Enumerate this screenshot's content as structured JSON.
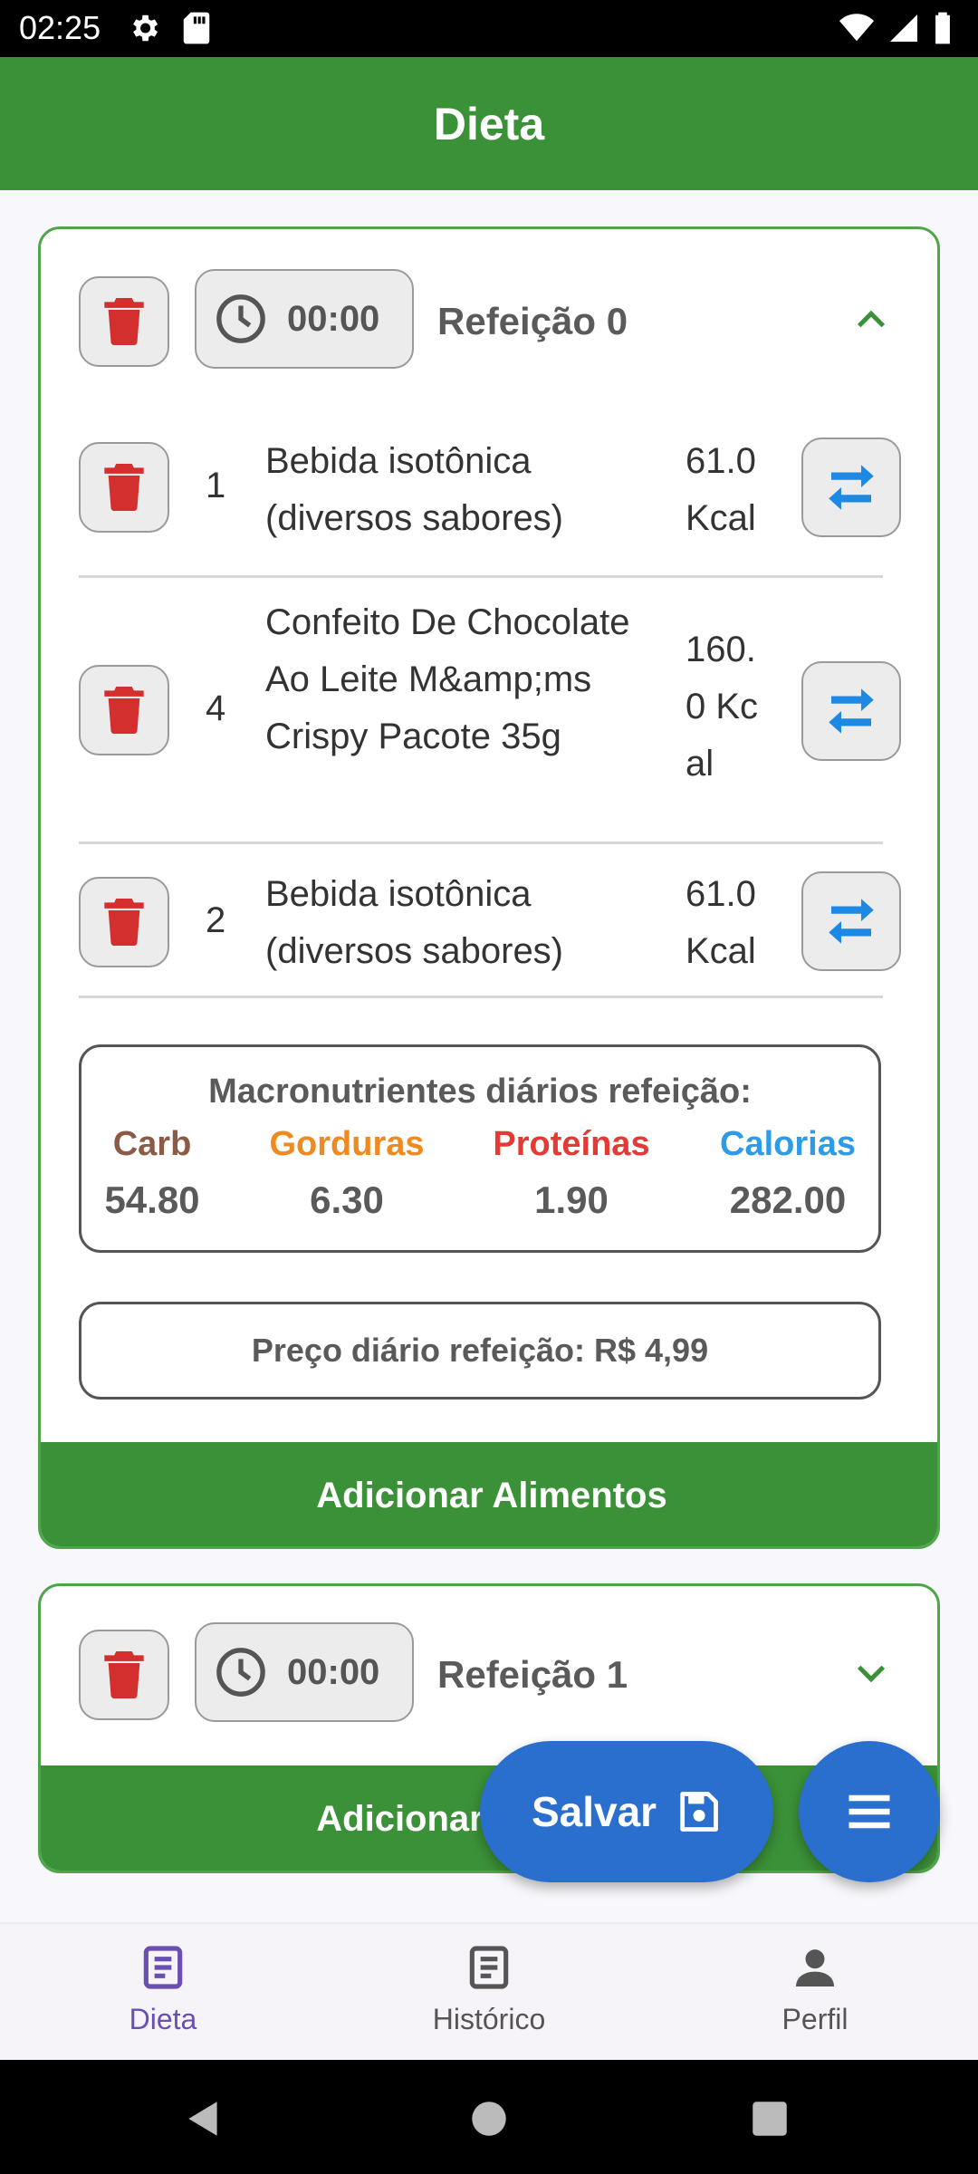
{
  "status_bar": {
    "time": "02:25"
  },
  "app_bar": {
    "title": "Dieta"
  },
  "meals": [
    {
      "time": "00:00",
      "title": "Refeição 0",
      "expanded": true,
      "foods": [
        {
          "qty": "1",
          "name": "Bebida isotônica (diversos sabores)",
          "kcal": "61.0 Kcal"
        },
        {
          "qty": "4",
          "name": "Confeito De Chocolate Ao Leite M&amp;ms Crispy Pacote 35g",
          "kcal": "160.0 Kcal"
        },
        {
          "qty": "2",
          "name": "Bebida isotônica (diversos sabores)",
          "kcal": "61.0 Kcal"
        }
      ],
      "macros": {
        "title": "Macronutrientes diários refeição:",
        "carb_label": "Carb",
        "carb_value": "54.80",
        "fat_label": "Gorduras",
        "fat_value": "6.30",
        "protein_label": "Proteínas",
        "protein_value": "1.90",
        "cal_label": "Calorias",
        "cal_value": "282.00"
      },
      "price": "Preço diário refeição: R$ 4,99",
      "add_label": "Adicionar Alimentos"
    },
    {
      "time": "00:00",
      "title": "Refeição 1",
      "expanded": false,
      "add_label": "Adicionar Alimentos"
    }
  ],
  "fab": {
    "save_label": "Salvar"
  },
  "bottom_nav": [
    {
      "label": "Dieta",
      "active": true
    },
    {
      "label": "Histórico",
      "active": false
    },
    {
      "label": "Perfil",
      "active": false
    }
  ],
  "colors": {
    "primary_green": "#3b9138",
    "delete_red": "#d32f2f",
    "swap_blue": "#1e88e5",
    "fab_blue": "#2a6fce",
    "carb": "#8d5a45",
    "fat": "#ef8a20",
    "protein": "#e53935",
    "calories": "#2e9be6",
    "nav_active": "#6a4fb3"
  }
}
